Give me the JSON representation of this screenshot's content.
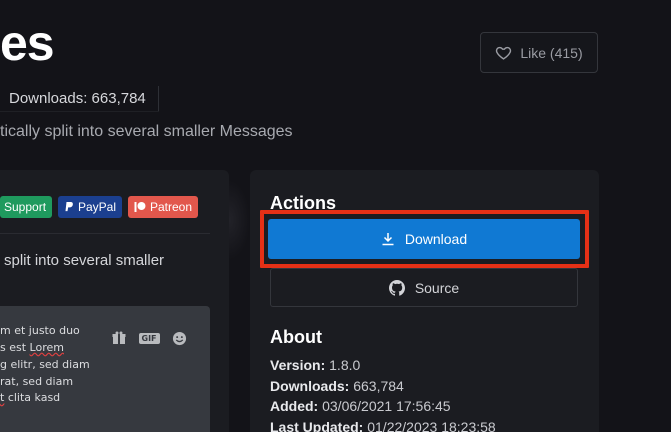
{
  "header": {
    "title": "es",
    "like_label": "Like (415)",
    "downloads": "Downloads: 663,784",
    "subtitle": "tically split into several smaller Messages"
  },
  "badges": [
    {
      "label": "Support"
    },
    {
      "label": "PayPal"
    },
    {
      "label": "Patreon"
    }
  ],
  "card": {
    "description": "split into several smaller",
    "preview_lines": [
      "m et justo duo",
      "s est Lorem",
      "g elitr, sed diam",
      "rat, sed diam",
      " clita kasd"
    ]
  },
  "actions": {
    "heading": "Actions",
    "download_label": "Download",
    "source_label": "Source"
  },
  "about": {
    "heading": "About",
    "version_label": "Version:",
    "version": "1.8.0",
    "downloads_label": "Downloads:",
    "downloads": "663,784",
    "added_label": "Added:",
    "added": "03/06/2021 17:56:45",
    "updated_label": "Last Updated:",
    "updated": "01/22/2023 18:23:58"
  },
  "colors": {
    "background": "#131318",
    "card": "#1b1c21",
    "accent": "#1079d3",
    "highlight": "#e53016"
  }
}
